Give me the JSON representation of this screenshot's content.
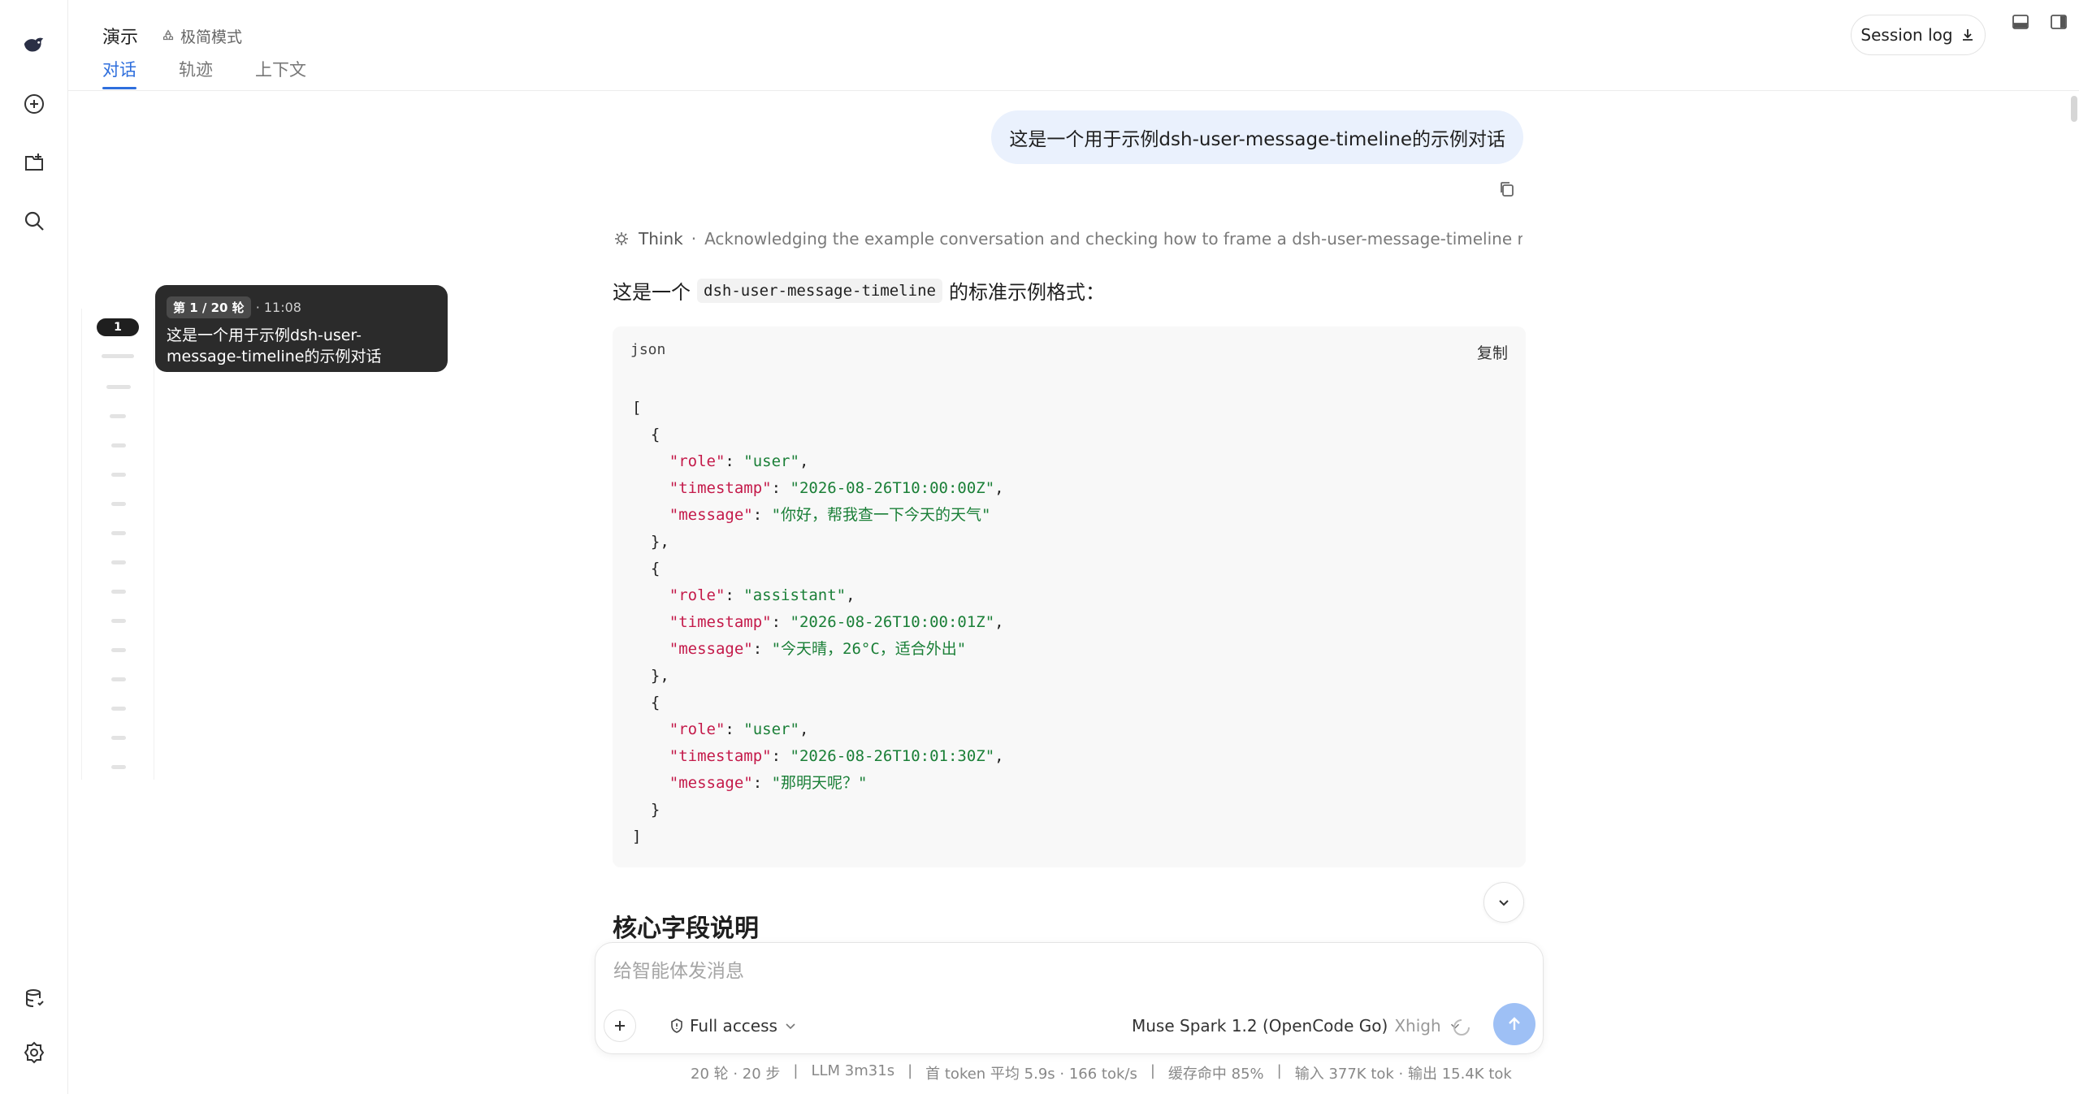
{
  "header": {
    "title": "演示",
    "mode_label": "极简模式",
    "tabs": [
      {
        "label": "对话",
        "active": true
      },
      {
        "label": "轨迹",
        "active": false
      },
      {
        "label": "上下文",
        "active": false
      }
    ],
    "session_log_label": "Session log"
  },
  "rail": {
    "icons": [
      "app-logo-icon",
      "new-chat-icon",
      "new-project-icon",
      "search-icon",
      "database-icon",
      "settings-icon"
    ]
  },
  "timeline": {
    "current_index": "1",
    "card_badge": "第 1 / 20 轮",
    "card_time": "· 11:08",
    "card_text": "这是一个用于示例dsh-user-message-timeline的示例对话"
  },
  "conversation": {
    "user_message": "这是一个用于示例dsh-user-message-timeline的示例对话",
    "think_label": "Think",
    "think_separator": "·",
    "think_summary": "Acknowledging the example conversation and checking how to frame a dsh-user-message-timeline respon...",
    "answer_intro_before": "这是一个",
    "answer_intro_code": "dsh-user-message-timeline",
    "answer_intro_after": "的标准示例格式：",
    "code_lang": "json",
    "code_copy_label": "复制",
    "entries": [
      {
        "role": "user",
        "timestamp": "2026-08-26T10:00:00Z",
        "message": "你好，帮我查一下今天的天气"
      },
      {
        "role": "assistant",
        "timestamp": "2026-08-26T10:00:01Z",
        "message": "今天晴，26°C，适合外出"
      },
      {
        "role": "user",
        "timestamp": "2026-08-26T10:01:30Z",
        "message": "那明天呢？"
      }
    ],
    "section_heading": "核心字段说明"
  },
  "composer": {
    "placeholder": "给智能体发消息",
    "value": "",
    "access_label": "Full access",
    "model_label": "Muse Spark 1.2 (OpenCode Go)",
    "effort_label": "Xhigh"
  },
  "stats": {
    "items": [
      "20 轮 · 20 步",
      "|",
      "LLM 3m31s",
      "|",
      "首 token 平均 5.9s · 166 tok/s",
      "|",
      "缓存命中 85%",
      "|",
      "输入 377K tok · 输出 15.4K tok"
    ]
  },
  "colors": {
    "accent": "#2f6fdd",
    "user_bubble": "#eaf1fd",
    "send_button": "#9ec0f5",
    "json_key": "#c41a4a",
    "json_string": "#1a7f37"
  }
}
